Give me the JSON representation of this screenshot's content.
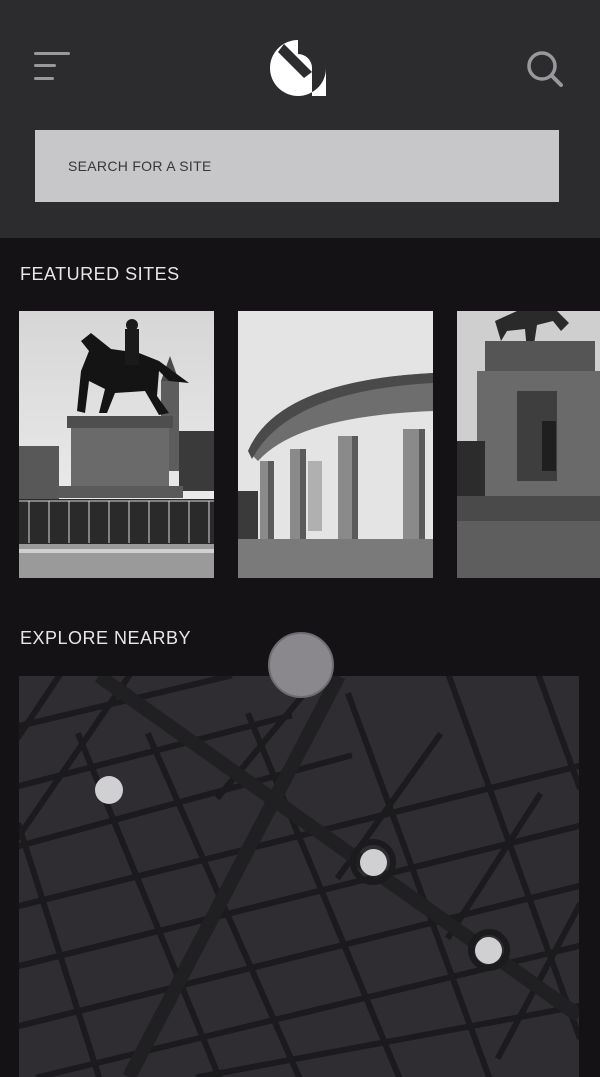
{
  "header": {
    "menu_icon": "hamburger-menu-icon",
    "logo_icon": "app-logo-icon",
    "search_icon": "magnifier-icon"
  },
  "search": {
    "placeholder": "SEARCH FOR A SITE"
  },
  "featured": {
    "title": "FEATURED SITES",
    "cards": [
      {
        "image": "equestrian-statue-photo"
      },
      {
        "image": "colonnade-monument-photo"
      },
      {
        "image": "monument-pedestal-photo"
      }
    ]
  },
  "nearby": {
    "title": "EXPLORE NEARBY",
    "map_pins": 3
  },
  "colors": {
    "header_bg": "#2c2b2e",
    "page_bg": "#141215",
    "search_bg": "#c7c6c9",
    "map_bg": "#2f2d31"
  }
}
